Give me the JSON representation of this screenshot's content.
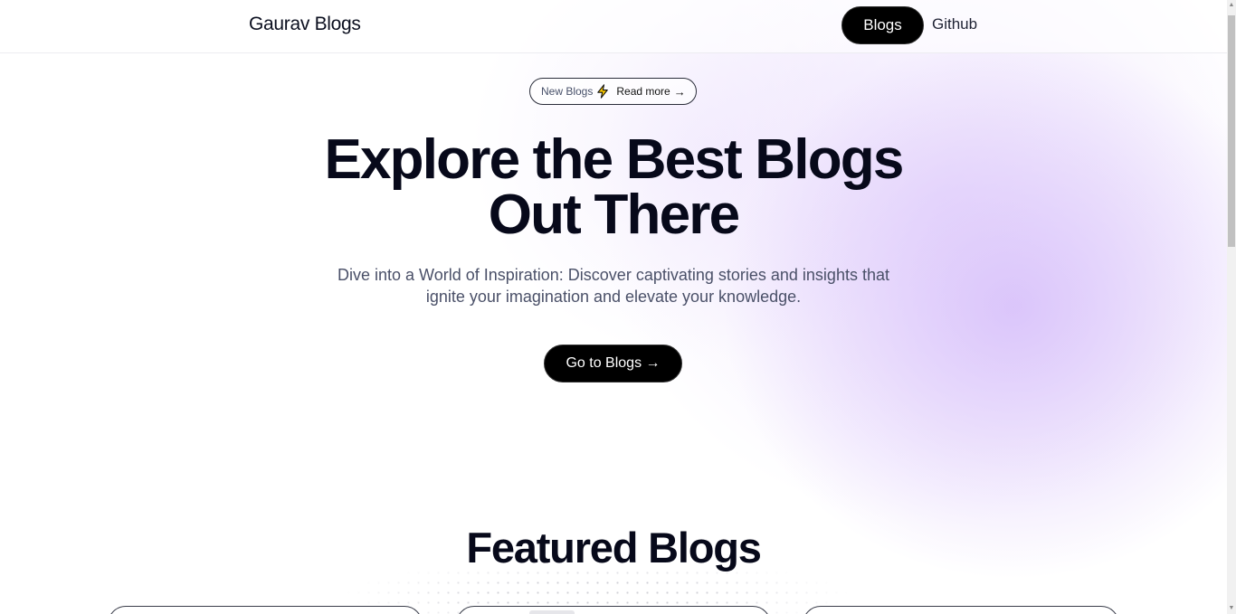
{
  "nav": {
    "brand": "Gaurav Blogs",
    "links": [
      {
        "label": "Blogs",
        "active": true
      },
      {
        "label": "Github",
        "active": false
      }
    ]
  },
  "announcement": {
    "tag": "New Blogs",
    "icon": "lightning-bolt-icon",
    "link": "Read more",
    "arrow": "→"
  },
  "hero": {
    "title_line1": "Explore the Best Blogs",
    "title_line2": "Out There",
    "subtitle_line1": "Dive into a World of Inspiration: Discover captivating stories and insights that",
    "subtitle_line2": "ignite your imagination and elevate your knowledge.",
    "cta_label": "Go to Blogs →"
  },
  "featured": {
    "title": "Featured Blogs"
  },
  "colors": {
    "primary": "#000000",
    "text": "#07091a",
    "muted": "#4a5068",
    "glow": "#d6befa",
    "bolt": "#f5c400"
  }
}
